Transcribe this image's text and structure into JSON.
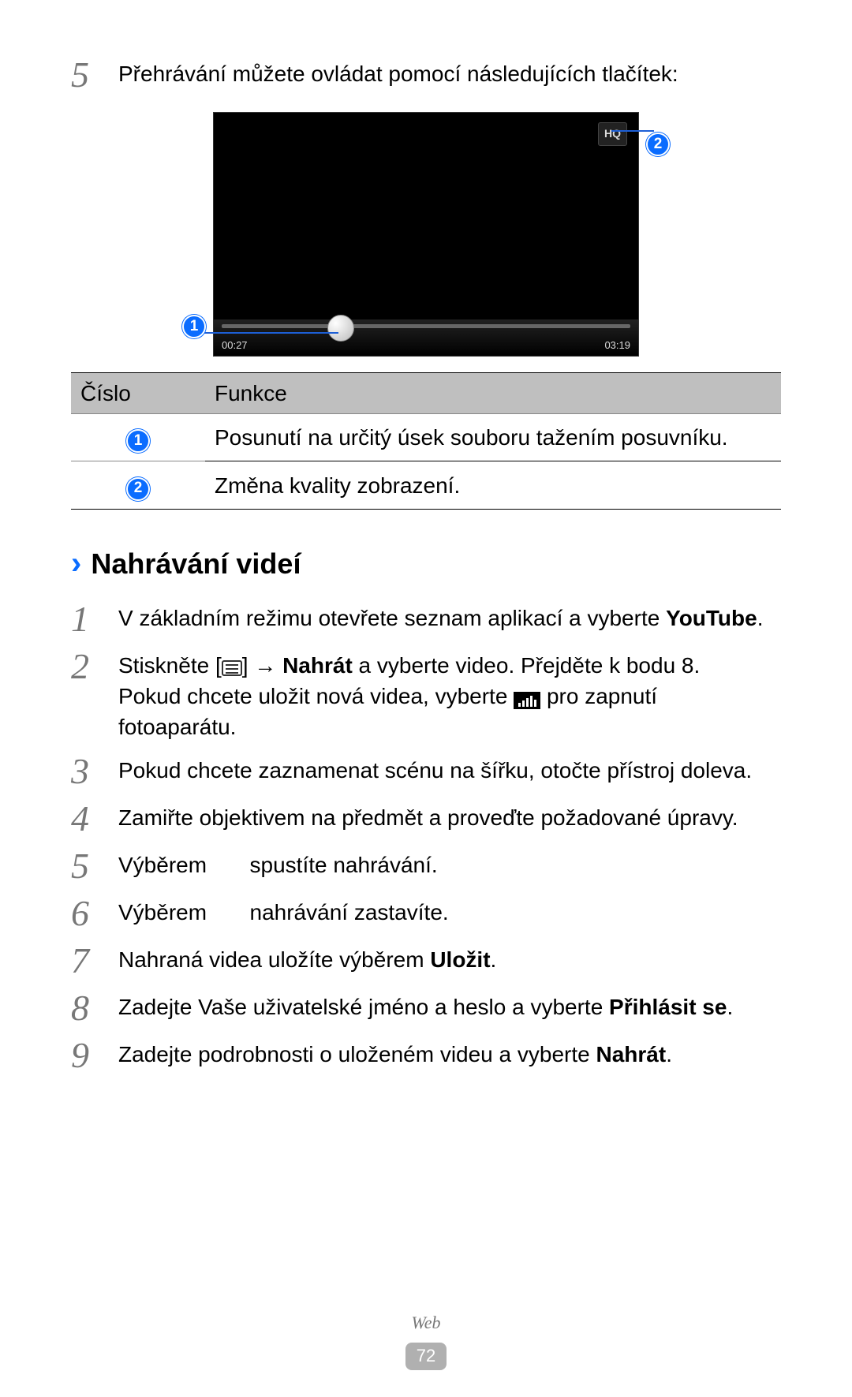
{
  "top_step": {
    "num": "5",
    "text": "Přehrávání můžete ovládat pomocí následujících tlačítek:"
  },
  "video": {
    "hq": "HQ",
    "time_l": "00:27",
    "time_r": "03:19",
    "callout1": "1",
    "callout2": "2"
  },
  "table": {
    "hdr_num": "Číslo",
    "hdr_func": "Funkce",
    "rows": [
      {
        "num": "1",
        "desc": "Posunutí na určitý úsek souboru tažením posuvníku."
      },
      {
        "num": "2",
        "desc": "Změna kvality zobrazení."
      }
    ]
  },
  "section": {
    "chevron": "›",
    "title": "Nahrávání videí"
  },
  "steps": {
    "s1": {
      "num": "1",
      "a": "V základním režimu otevřete seznam aplikací a vyberte ",
      "b": "YouTube",
      "c": "."
    },
    "s2": {
      "num": "2",
      "a": "Stiskněte [",
      "b": "] → ",
      "c": "Nahrát",
      "d": " a vyberte video. Přejděte k bodu 8.",
      "line2a": "Pokud chcete uložit nová videa, vyberte ",
      "line2b": " pro zapnutí fotoaparátu."
    },
    "s3": {
      "num": "3",
      "text": "Pokud chcete zaznamenat scénu na šířku, otočte přístroj doleva."
    },
    "s4": {
      "num": "4",
      "text": "Zamiřte objektivem na předmět a proveďte požadované úpravy."
    },
    "s5": {
      "num": "5",
      "a": "Výběrem",
      "b": "spustíte nahrávání."
    },
    "s6": {
      "num": "6",
      "a": "Výběrem",
      "b": "nahrávání zastavíte."
    },
    "s7": {
      "num": "7",
      "a": "Nahraná videa uložíte výběrem ",
      "b": "Uložit",
      "c": "."
    },
    "s8": {
      "num": "8",
      "a": "Zadejte Vaše uživatelské jméno a heslo a vyberte ",
      "b": "Přihlásit se",
      "c": "."
    },
    "s9": {
      "num": "9",
      "a": "Zadejte podrobnosti o uloženém videu a vyberte ",
      "b": "Nahrát",
      "c": "."
    }
  },
  "footer": {
    "chapter": "Web",
    "page": "72"
  }
}
